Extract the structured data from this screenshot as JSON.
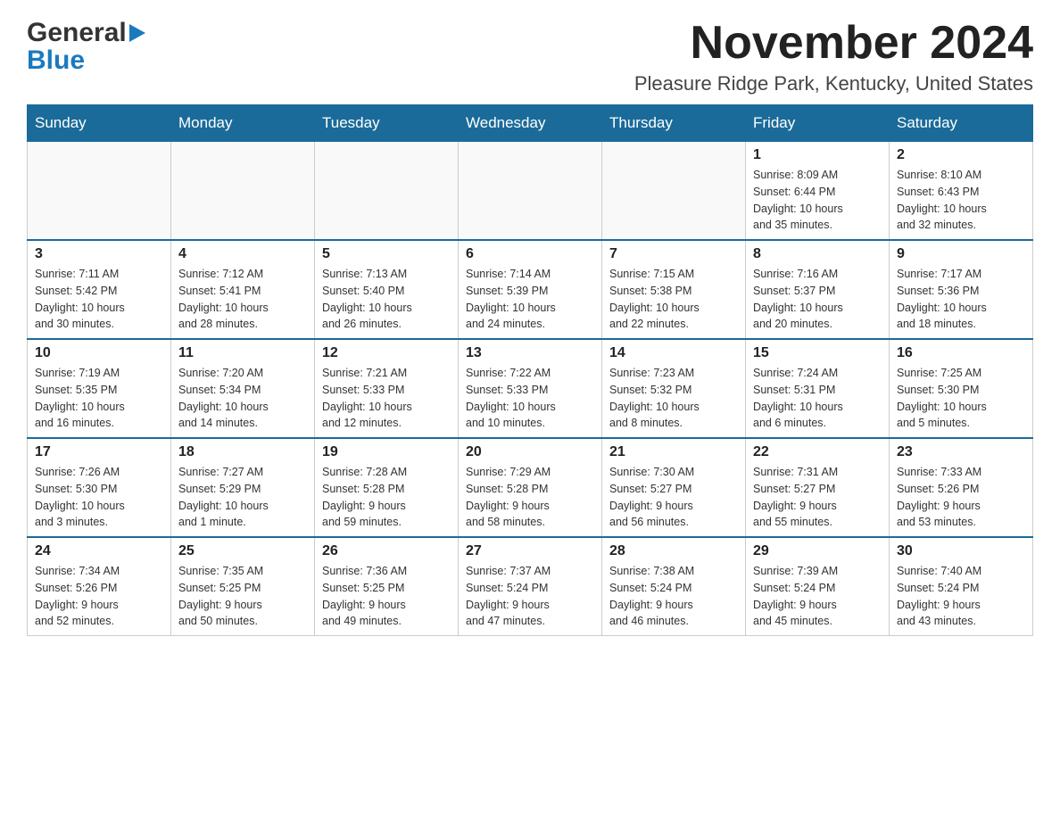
{
  "logo": {
    "general": "General",
    "blue": "Blue"
  },
  "title": "November 2024",
  "subtitle": "Pleasure Ridge Park, Kentucky, United States",
  "weekdays": [
    "Sunday",
    "Monday",
    "Tuesday",
    "Wednesday",
    "Thursday",
    "Friday",
    "Saturday"
  ],
  "weeks": [
    [
      {
        "day": "",
        "info": ""
      },
      {
        "day": "",
        "info": ""
      },
      {
        "day": "",
        "info": ""
      },
      {
        "day": "",
        "info": ""
      },
      {
        "day": "",
        "info": ""
      },
      {
        "day": "1",
        "info": "Sunrise: 8:09 AM\nSunset: 6:44 PM\nDaylight: 10 hours\nand 35 minutes."
      },
      {
        "day": "2",
        "info": "Sunrise: 8:10 AM\nSunset: 6:43 PM\nDaylight: 10 hours\nand 32 minutes."
      }
    ],
    [
      {
        "day": "3",
        "info": "Sunrise: 7:11 AM\nSunset: 5:42 PM\nDaylight: 10 hours\nand 30 minutes."
      },
      {
        "day": "4",
        "info": "Sunrise: 7:12 AM\nSunset: 5:41 PM\nDaylight: 10 hours\nand 28 minutes."
      },
      {
        "day": "5",
        "info": "Sunrise: 7:13 AM\nSunset: 5:40 PM\nDaylight: 10 hours\nand 26 minutes."
      },
      {
        "day": "6",
        "info": "Sunrise: 7:14 AM\nSunset: 5:39 PM\nDaylight: 10 hours\nand 24 minutes."
      },
      {
        "day": "7",
        "info": "Sunrise: 7:15 AM\nSunset: 5:38 PM\nDaylight: 10 hours\nand 22 minutes."
      },
      {
        "day": "8",
        "info": "Sunrise: 7:16 AM\nSunset: 5:37 PM\nDaylight: 10 hours\nand 20 minutes."
      },
      {
        "day": "9",
        "info": "Sunrise: 7:17 AM\nSunset: 5:36 PM\nDaylight: 10 hours\nand 18 minutes."
      }
    ],
    [
      {
        "day": "10",
        "info": "Sunrise: 7:19 AM\nSunset: 5:35 PM\nDaylight: 10 hours\nand 16 minutes."
      },
      {
        "day": "11",
        "info": "Sunrise: 7:20 AM\nSunset: 5:34 PM\nDaylight: 10 hours\nand 14 minutes."
      },
      {
        "day": "12",
        "info": "Sunrise: 7:21 AM\nSunset: 5:33 PM\nDaylight: 10 hours\nand 12 minutes."
      },
      {
        "day": "13",
        "info": "Sunrise: 7:22 AM\nSunset: 5:33 PM\nDaylight: 10 hours\nand 10 minutes."
      },
      {
        "day": "14",
        "info": "Sunrise: 7:23 AM\nSunset: 5:32 PM\nDaylight: 10 hours\nand 8 minutes."
      },
      {
        "day": "15",
        "info": "Sunrise: 7:24 AM\nSunset: 5:31 PM\nDaylight: 10 hours\nand 6 minutes."
      },
      {
        "day": "16",
        "info": "Sunrise: 7:25 AM\nSunset: 5:30 PM\nDaylight: 10 hours\nand 5 minutes."
      }
    ],
    [
      {
        "day": "17",
        "info": "Sunrise: 7:26 AM\nSunset: 5:30 PM\nDaylight: 10 hours\nand 3 minutes."
      },
      {
        "day": "18",
        "info": "Sunrise: 7:27 AM\nSunset: 5:29 PM\nDaylight: 10 hours\nand 1 minute."
      },
      {
        "day": "19",
        "info": "Sunrise: 7:28 AM\nSunset: 5:28 PM\nDaylight: 9 hours\nand 59 minutes."
      },
      {
        "day": "20",
        "info": "Sunrise: 7:29 AM\nSunset: 5:28 PM\nDaylight: 9 hours\nand 58 minutes."
      },
      {
        "day": "21",
        "info": "Sunrise: 7:30 AM\nSunset: 5:27 PM\nDaylight: 9 hours\nand 56 minutes."
      },
      {
        "day": "22",
        "info": "Sunrise: 7:31 AM\nSunset: 5:27 PM\nDaylight: 9 hours\nand 55 minutes."
      },
      {
        "day": "23",
        "info": "Sunrise: 7:33 AM\nSunset: 5:26 PM\nDaylight: 9 hours\nand 53 minutes."
      }
    ],
    [
      {
        "day": "24",
        "info": "Sunrise: 7:34 AM\nSunset: 5:26 PM\nDaylight: 9 hours\nand 52 minutes."
      },
      {
        "day": "25",
        "info": "Sunrise: 7:35 AM\nSunset: 5:25 PM\nDaylight: 9 hours\nand 50 minutes."
      },
      {
        "day": "26",
        "info": "Sunrise: 7:36 AM\nSunset: 5:25 PM\nDaylight: 9 hours\nand 49 minutes."
      },
      {
        "day": "27",
        "info": "Sunrise: 7:37 AM\nSunset: 5:24 PM\nDaylight: 9 hours\nand 47 minutes."
      },
      {
        "day": "28",
        "info": "Sunrise: 7:38 AM\nSunset: 5:24 PM\nDaylight: 9 hours\nand 46 minutes."
      },
      {
        "day": "29",
        "info": "Sunrise: 7:39 AM\nSunset: 5:24 PM\nDaylight: 9 hours\nand 45 minutes."
      },
      {
        "day": "30",
        "info": "Sunrise: 7:40 AM\nSunset: 5:24 PM\nDaylight: 9 hours\nand 43 minutes."
      }
    ]
  ]
}
